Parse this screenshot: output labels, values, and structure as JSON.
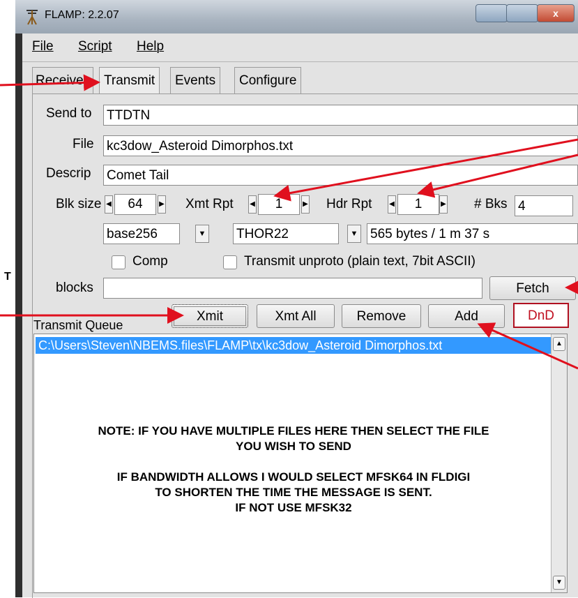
{
  "window": {
    "title": "FLAMP: 2.2.07",
    "close_glyph": "x"
  },
  "menu": {
    "file": "File",
    "script": "Script",
    "help": "Help"
  },
  "tabs": [
    {
      "label": "Receive"
    },
    {
      "label": "Transmit"
    },
    {
      "label": "Events"
    },
    {
      "label": "Configure"
    }
  ],
  "form": {
    "send_to_label": "Send to",
    "send_to_value": "TTDTN",
    "file_label": "File",
    "file_value": "kc3dow_Asteroid Dimorphos.txt",
    "descrip_label": "Descrip",
    "descrip_value": "Comet Tail",
    "blk_size_label": "Blk size",
    "blk_size_value": "64",
    "xmt_rpt_label": "Xmt Rpt",
    "xmt_rpt_value": "1",
    "hdr_rpt_label": "Hdr Rpt",
    "hdr_rpt_value": "1",
    "bks_label": "# Bks",
    "bks_value": "4",
    "encoding_value": "base256",
    "mode_value": "THOR22",
    "size_time_value": "565 bytes / 1 m 37 s",
    "comp_label": "Comp",
    "unproto_label": "Transmit unproto (plain text, 7bit ASCII)",
    "blocks_label": "blocks",
    "blocks_value": "",
    "fetch_label": "Fetch"
  },
  "queue": {
    "label": "Transmit Queue",
    "buttons": {
      "xmit": "Xmit",
      "xmt_all": "Xmt All",
      "remove": "Remove",
      "add": "Add",
      "dnd": "DnD"
    },
    "items": [
      "C:\\Users\\Steven\\NBEMS.files\\FLAMP\\tx\\kc3dow_Asteroid Dimorphos.txt"
    ]
  },
  "note": {
    "line1": "NOTE: IF YOU HAVE MULTIPLE FILES HERE THEN SELECT THE FILE",
    "line2": "YOU WISH TO SEND",
    "line3": "IF BANDWIDTH ALLOWS I WOULD SELECT MFSK64 IN FLDIGI",
    "line4": "TO SHORTEN THE TIME THE MESSAGE IS SENT.",
    "line5": "IF NOT USE MFSK32"
  },
  "annotations": {
    "left_letter": "T"
  },
  "colors": {
    "selection": "#3399ff",
    "arrow": "#e0101e",
    "dnd": "#c01020"
  }
}
